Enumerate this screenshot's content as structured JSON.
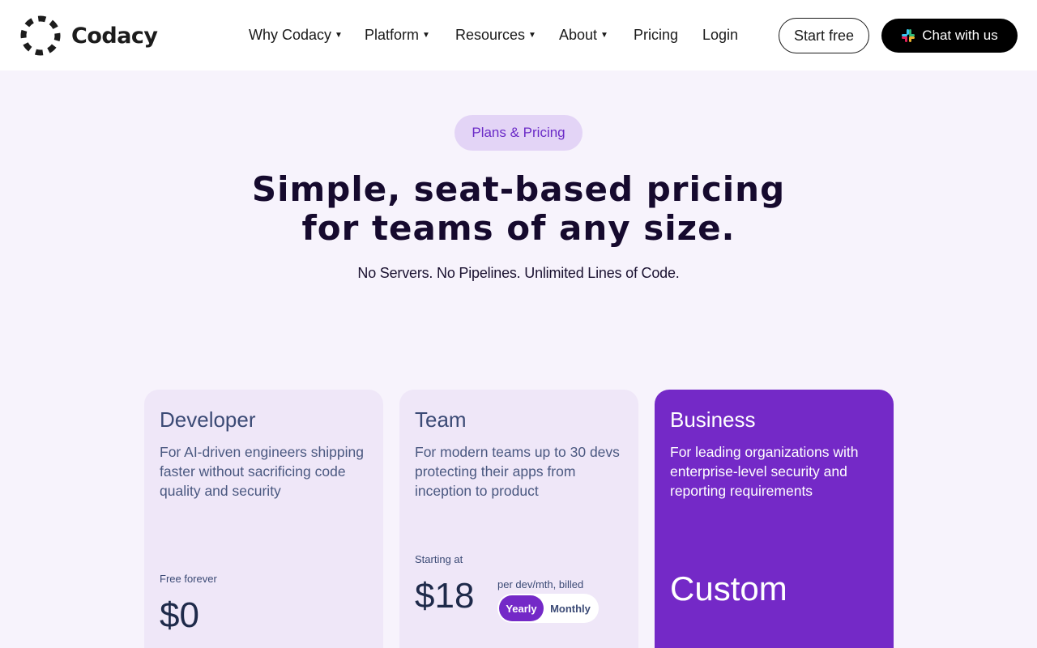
{
  "header": {
    "logo_text": "Codacy",
    "nav": [
      {
        "label": "Why Codacy",
        "has_dropdown": true
      },
      {
        "label": "Platform",
        "has_dropdown": true
      },
      {
        "label": "Resources",
        "has_dropdown": true
      },
      {
        "label": "About",
        "has_dropdown": true
      },
      {
        "label": "Pricing",
        "has_dropdown": false
      },
      {
        "label": "Login",
        "has_dropdown": false
      }
    ],
    "start_free_label": "Start free",
    "chat_label": "Chat with us",
    "chat_icon": "slack-icon"
  },
  "hero": {
    "pill_label": "Plans & Pricing",
    "headline_line1": "Simple, seat-based pricing",
    "headline_line2": "for teams of any size.",
    "subline": "No Servers. No Pipelines. Unlimited Lines of Code."
  },
  "plans": [
    {
      "title": "Developer",
      "description": "For AI-driven engineers shipping faster without sacrificing code quality and security",
      "price_label": "Free forever",
      "price": "$0"
    },
    {
      "title": "Team",
      "description": "For modern teams up to 30 devs protecting their apps from inception to product",
      "price_label": "Starting at",
      "price": "$18",
      "billing_note": "per dev/mth, billed",
      "billing_options": [
        "Yearly",
        "Monthly"
      ],
      "billing_selected": "Yearly"
    },
    {
      "title": "Business",
      "description": "For leading organizations with enterprise-level security and reporting requirements",
      "price": "Custom"
    }
  ],
  "colors": {
    "accent": "#7429c7",
    "pill_bg": "#e3d4f6",
    "page_bg": "#f7f3fc",
    "card_bg": "#efe7f8"
  }
}
